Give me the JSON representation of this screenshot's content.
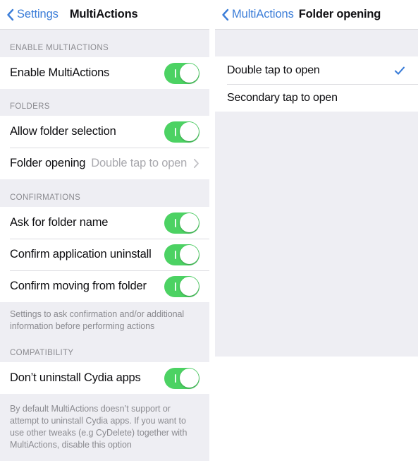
{
  "theme": {
    "accent_blue": "#3b7dd8",
    "check_blue": "#3b7dd8",
    "switch_on_green": "#4cd263",
    "group_bg": "#eeeef3",
    "cell_bg": "#ffffff",
    "separator": "#dcdce0",
    "label_gray": "#8b8b90",
    "value_gray": "#a9a9ae"
  },
  "left_panel": {
    "navbar": {
      "back_label": "Settings",
      "back_icon": "chevron-left-icon",
      "title": "MultiActions"
    },
    "sections": [
      {
        "header": "ENABLE MULTIACTIONS",
        "rows": [
          {
            "title": "Enable MultiActions",
            "control": "switch",
            "value": "on"
          }
        ],
        "footer": ""
      },
      {
        "header": "FOLDERS",
        "rows": [
          {
            "title": "Allow folder selection",
            "control": "switch",
            "value": "on"
          },
          {
            "title": "Folder opening",
            "control": "disclosure",
            "value": "Double tap to open"
          }
        ],
        "footer": ""
      },
      {
        "header": "CONFIRMATIONS",
        "rows": [
          {
            "title": "Ask for folder name",
            "control": "switch",
            "value": "on"
          },
          {
            "title": "Confirm application uninstall",
            "control": "switch",
            "value": "on"
          },
          {
            "title": "Confirm moving from folder",
            "control": "switch",
            "value": "on"
          }
        ],
        "footer": "Settings to ask confirmation and/or additional information before performing actions"
      },
      {
        "header": "COMPATIBILITY",
        "rows": [
          {
            "title": "Don’t uninstall Cydia apps",
            "control": "switch",
            "value": "on"
          }
        ],
        "footer": "By default MultiActions doesn’t support or attempt to uninstall Cydia apps. If you want to use other tweaks (e.g CyDelete) together with MultiActions, disable this option"
      }
    ]
  },
  "right_panel": {
    "navbar": {
      "back_label": "MultiActions",
      "back_icon": "chevron-left-icon",
      "title": "Folder opening"
    },
    "options": [
      {
        "label": "Double tap to open",
        "selected": true,
        "check_icon": "checkmark-icon"
      },
      {
        "label": "Secondary tap to open",
        "selected": false,
        "check_icon": ""
      }
    ]
  }
}
